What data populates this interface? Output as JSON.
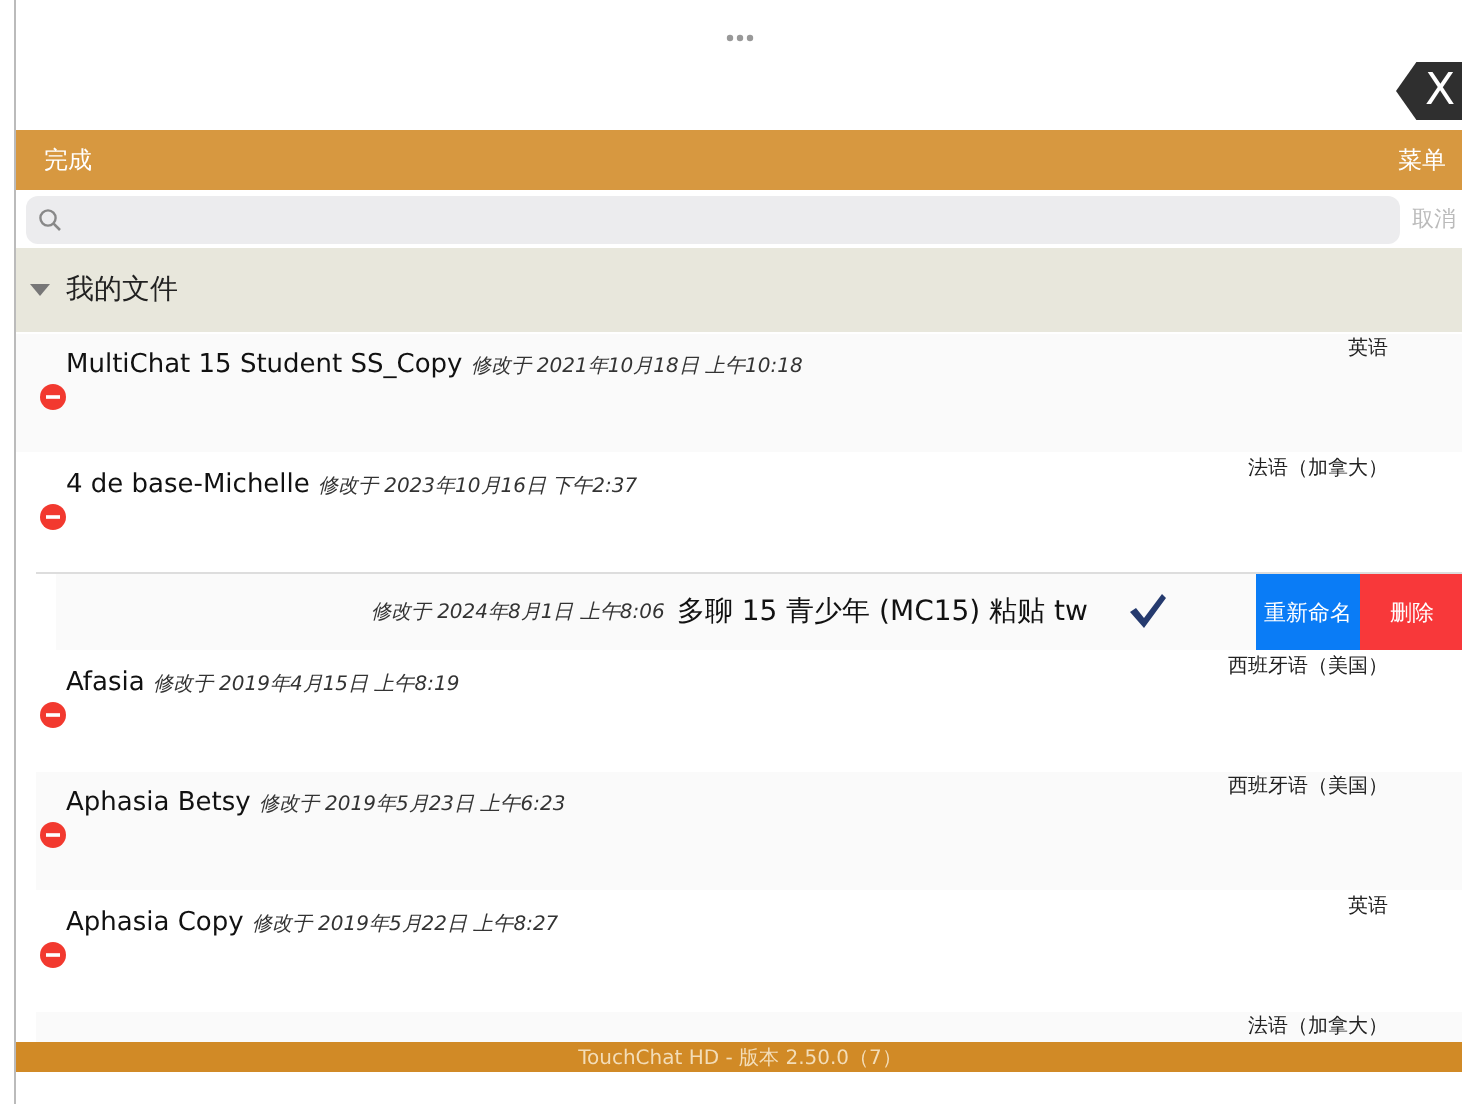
{
  "close_button": {
    "label": "X"
  },
  "nav_bar": {
    "left": "完成",
    "right": "菜单"
  },
  "search": {
    "cancel": "取消"
  },
  "section": {
    "title": "我的文件",
    "expanded": true
  },
  "files": [
    {
      "kind": "normal",
      "name": "MultiChat 15 Student SS_Copy",
      "modified": "修改于 2021年10月18日 上午10:18",
      "language": "英语"
    },
    {
      "kind": "normal",
      "name": "4 de base-Michelle",
      "modified": "修改于 2023年10月16日 下午2:37",
      "language": "法语（加拿大）"
    },
    {
      "kind": "swiped",
      "name": "多聊 15 青少年 (MC15) 粘贴 tw",
      "modified": "修改于 2024年8月1日 上午8:06",
      "checked": true,
      "actions": [
        {
          "kind": "rename",
          "label": "重新命名"
        },
        {
          "kind": "delete",
          "label": "删除"
        }
      ]
    },
    {
      "kind": "normal",
      "name": "Afasia",
      "modified": "修改于 2019年4月15日 上午8:19",
      "language": "西班牙语（美国）"
    },
    {
      "kind": "normal",
      "name": "Aphasia Betsy",
      "modified": "修改于 2019年5月23日 上午6:23",
      "language": "西班牙语（美国）"
    },
    {
      "kind": "normal",
      "name": "Aphasia Copy",
      "modified": "修改于 2019年5月22日 上午8:27",
      "language": "英语"
    },
    {
      "kind": "normal",
      "language": "法语（加拿大）"
    }
  ],
  "footer": "TouchChat HD - 版本 2.50.0（7）"
}
